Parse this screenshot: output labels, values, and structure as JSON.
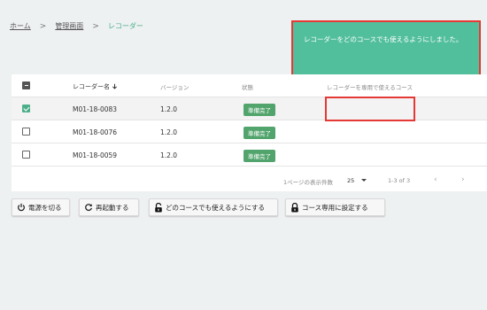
{
  "breadcrumb": {
    "home": "ホーム",
    "separator": ">",
    "admin": "管理画面",
    "current": "レコーダー"
  },
  "toast": {
    "message": "レコーダーをどのコースでも使えるようにしました。"
  },
  "table": {
    "headers": {
      "name": "レコーダー名",
      "sort_icon": "arrow-down-icon",
      "version": "バージョン",
      "status": "状態",
      "course": "レコーダーを専用で使えるコース"
    },
    "rows": [
      {
        "name": "M01-18-0083",
        "version": "1.2.0",
        "status": "準備完了",
        "course": "",
        "checked": true
      },
      {
        "name": "M01-18-0076",
        "version": "1.2.0",
        "status": "準備完了",
        "course": "",
        "checked": false
      },
      {
        "name": "M01-18-0059",
        "version": "1.2.0",
        "status": "準備完了",
        "course": "",
        "checked": false
      }
    ]
  },
  "pagination": {
    "rows_per_page_label": "1ページの表示件数",
    "rows_per_page_value": "25",
    "range": "1-3 of 3",
    "prev": "‹",
    "next": "›"
  },
  "actions": {
    "power_off": "電源を切る",
    "restart": "再起動する",
    "unlock_all": "どのコースでも使えるようにする",
    "lock_course": "コース専用に設定する"
  },
  "colors": {
    "accent": "#52bf9c",
    "badge": "#52a46d",
    "highlight_border": "#e53935",
    "background": "#eef1f2"
  }
}
